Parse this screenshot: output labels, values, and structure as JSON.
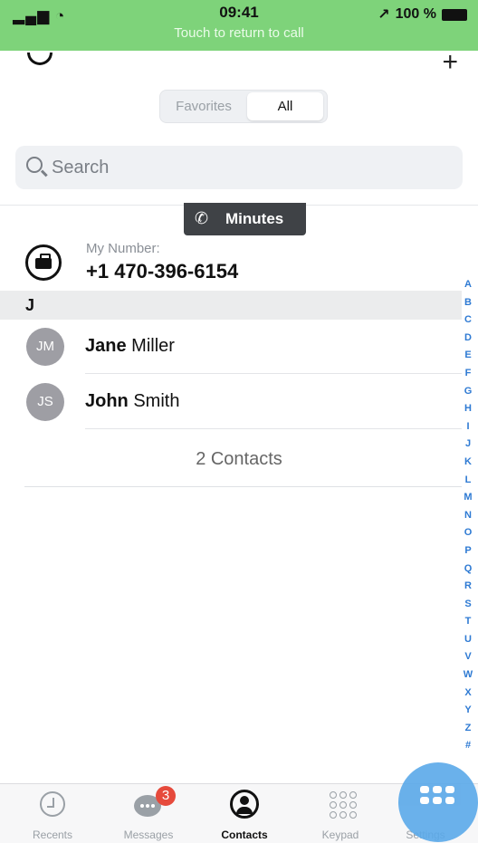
{
  "status_bar": {
    "signal": "▂▄▆",
    "wifi": "◔",
    "time": "09:41",
    "call_hint": "Touch to return to call",
    "location_arrow": "↗",
    "battery": "100 %"
  },
  "header": {
    "add_symbol": "+",
    "segments": {
      "favorites": "Favorites",
      "all": "All",
      "selected": "All"
    }
  },
  "search": {
    "placeholder": "Search"
  },
  "minutes_tab": {
    "label": "Minutes",
    "icon": "phone-swap-icon"
  },
  "my_number": {
    "label": "My Number:",
    "value": "+1 470-396-6154"
  },
  "section": {
    "letter": "J"
  },
  "contacts": [
    {
      "initials": "JM",
      "first": "Jane",
      "last": "Miller"
    },
    {
      "initials": "JS",
      "first": "John",
      "last": "Smith"
    }
  ],
  "contact_count": "2 Contacts",
  "index_letters": [
    "A",
    "B",
    "C",
    "D",
    "E",
    "F",
    "G",
    "H",
    "I",
    "J",
    "K",
    "L",
    "M",
    "N",
    "O",
    "P",
    "Q",
    "R",
    "S",
    "T",
    "U",
    "V",
    "W",
    "X",
    "Y",
    "Z",
    "#"
  ],
  "tabbar": {
    "recents": "Recents",
    "messages": "Messages",
    "messages_badge": "3",
    "contacts": "Contacts",
    "keypad": "Keypad",
    "settings": "Settings",
    "active": "Contacts"
  },
  "colors": {
    "call_banner": "#7ed37a",
    "index_accent": "#2e7ad3",
    "badge": "#e64a3c",
    "fab": "#5aa9e9"
  }
}
